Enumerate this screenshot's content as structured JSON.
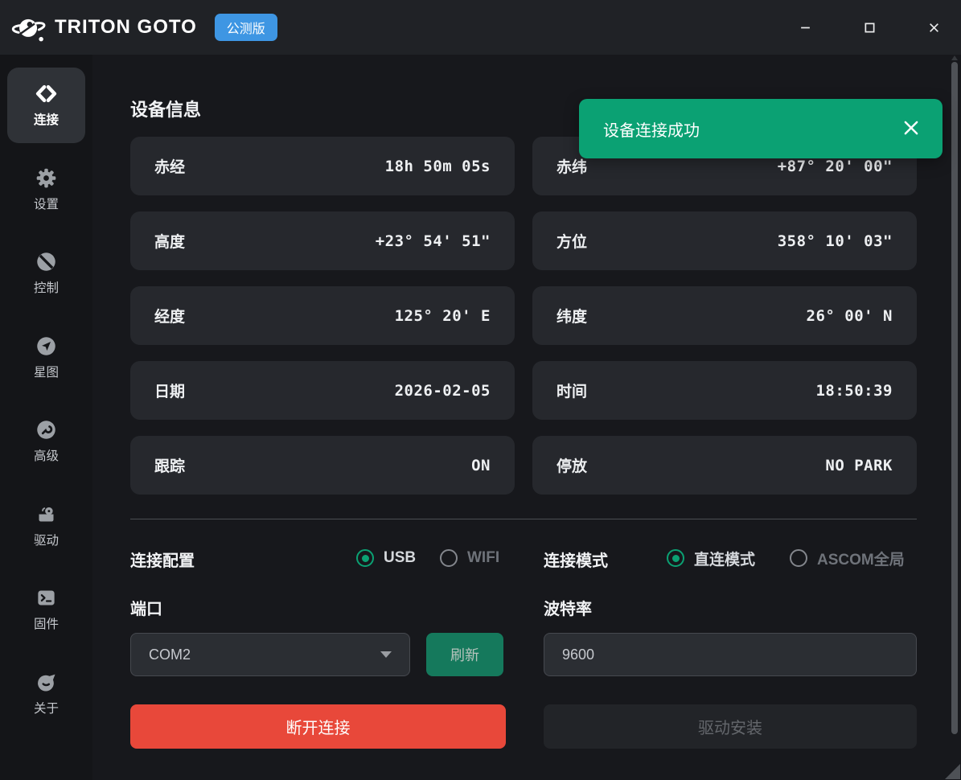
{
  "window": {
    "title": "TRITON GOTO",
    "badge": "公测版"
  },
  "sidebar": {
    "items": [
      {
        "label": "连接",
        "icon": "connect-icon",
        "active": true
      },
      {
        "label": "设置",
        "icon": "gear-icon",
        "active": false
      },
      {
        "label": "控制",
        "icon": "control-icon",
        "active": false
      },
      {
        "label": "星图",
        "icon": "starmap-icon",
        "active": false
      },
      {
        "label": "高级",
        "icon": "wrench-icon",
        "active": false
      },
      {
        "label": "驱动",
        "icon": "drive-icon",
        "active": false
      },
      {
        "label": "固件",
        "icon": "terminal-icon",
        "active": false
      },
      {
        "label": "关于",
        "icon": "about-icon",
        "active": false
      }
    ]
  },
  "toast": {
    "message": "设备连接成功"
  },
  "device_info": {
    "heading": "设备信息",
    "fields": [
      {
        "label": "赤经",
        "value": "18h 50m 05s"
      },
      {
        "label": "赤纬",
        "value": "+87° 20' 00\""
      },
      {
        "label": "高度",
        "value": "+23° 54' 51\""
      },
      {
        "label": "方位",
        "value": "358° 10' 03\""
      },
      {
        "label": "经度",
        "value": "125° 20' E"
      },
      {
        "label": "纬度",
        "value": "26° 00' N"
      },
      {
        "label": "日期",
        "value": "2026-02-05"
      },
      {
        "label": "时间",
        "value": "18:50:39"
      },
      {
        "label": "跟踪",
        "value": "ON"
      },
      {
        "label": "停放",
        "value": "NO PARK"
      }
    ]
  },
  "connection": {
    "config_label": "连接配置",
    "config_options": [
      {
        "label": "USB",
        "selected": true
      },
      {
        "label": "WIFI",
        "selected": false
      }
    ],
    "mode_label": "连接模式",
    "mode_options": [
      {
        "label": "直连模式",
        "selected": true
      },
      {
        "label": "ASCOM全局",
        "selected": false
      }
    ],
    "port_label": "端口",
    "port_value": "COM2",
    "refresh_label": "刷新",
    "baud_label": "波特率",
    "baud_value": "9600",
    "disconnect_label": "断开连接",
    "driver_install_label": "驱动安装"
  },
  "colors": {
    "accent_green": "#0ba173",
    "badge_blue": "#3e96e3",
    "danger_red": "#e8483a"
  }
}
